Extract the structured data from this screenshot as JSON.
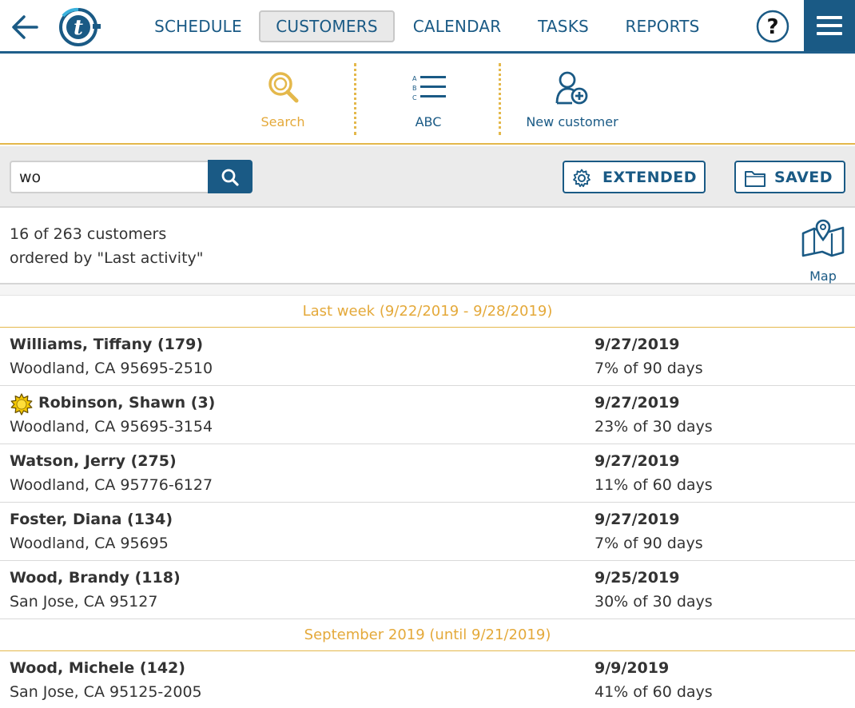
{
  "nav": {
    "items": [
      "SCHEDULE",
      "CUSTOMERS",
      "CALENDAR",
      "TASKS",
      "REPORTS"
    ],
    "active": "CUSTOMERS",
    "icons": {
      "back": "back-arrow-icon",
      "help": "help-question-icon",
      "menu": "hamburger-menu-icon",
      "logo": "t-logo"
    }
  },
  "toolbar": {
    "search_label": "Search",
    "abc_label": "ABC",
    "new_customer_label": "New customer",
    "accent_color": "#e4b84b"
  },
  "search": {
    "value": "wo",
    "extended_label": "EXTENDED",
    "saved_label": "SAVED"
  },
  "summary": {
    "count_text": "16 of 263 customers",
    "order_text": "ordered by \"Last activity\"",
    "map_label": "Map"
  },
  "groups": [
    {
      "title": "Last week (9/22/2019 - 9/28/2019)",
      "customers": [
        {
          "name": "Williams, Tiffany (179)",
          "address": "Woodland, CA 95695-2510",
          "date": "9/27/2019",
          "progress": "7% of 90 days",
          "badge": ""
        },
        {
          "name": "Robinson, Shawn (3)",
          "address": "Woodland, CA 95695-3154",
          "date": "9/27/2019",
          "progress": "23% of 30 days",
          "badge": "sun-badge-icon"
        },
        {
          "name": "Watson, Jerry (275)",
          "address": "Woodland, CA 95776-6127",
          "date": "9/27/2019",
          "progress": "11% of 60 days",
          "badge": ""
        },
        {
          "name": "Foster, Diana (134)",
          "address": "Woodland, CA 95695",
          "date": "9/27/2019",
          "progress": "7% of 90 days",
          "badge": ""
        },
        {
          "name": "Wood, Brandy (118)",
          "address": "San Jose, CA 95127",
          "date": "9/25/2019",
          "progress": "30% of 30 days",
          "badge": ""
        }
      ]
    },
    {
      "title": "September 2019 (until 9/21/2019)",
      "customers": [
        {
          "name": "Wood, Michele (142)",
          "address": "San Jose, CA 95125-2005",
          "date": "9/9/2019",
          "progress": "41% of 60 days",
          "badge": ""
        }
      ]
    }
  ],
  "colors": {
    "primary": "#1a5a85",
    "accent": "#e4b84b",
    "text": "#333333"
  }
}
